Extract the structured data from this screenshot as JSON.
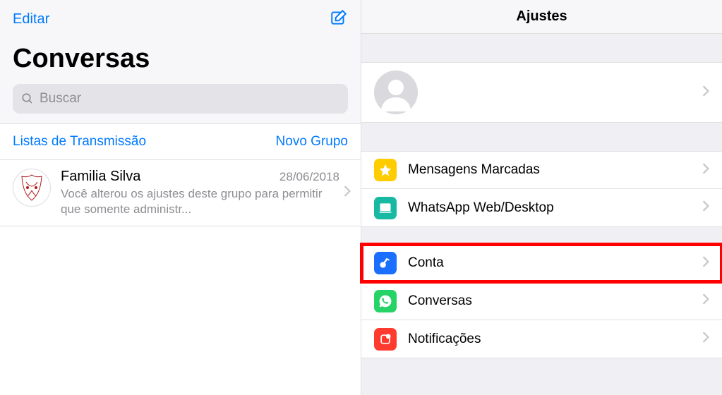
{
  "left": {
    "edit": "Editar",
    "title": "Conversas",
    "search_placeholder": "Buscar",
    "broadcast": "Listas de Transmissão",
    "new_group": "Novo Grupo",
    "chat": {
      "name": "Familia Silva",
      "date": "28/06/2018",
      "preview": "Você alterou os ajustes deste grupo para permitir que somente administr..."
    }
  },
  "right": {
    "title": "Ajustes",
    "items": {
      "starred": "Mensagens Marcadas",
      "web": "WhatsApp Web/Desktop",
      "account": "Conta",
      "chats": "Conversas",
      "notifications": "Notificações"
    }
  }
}
